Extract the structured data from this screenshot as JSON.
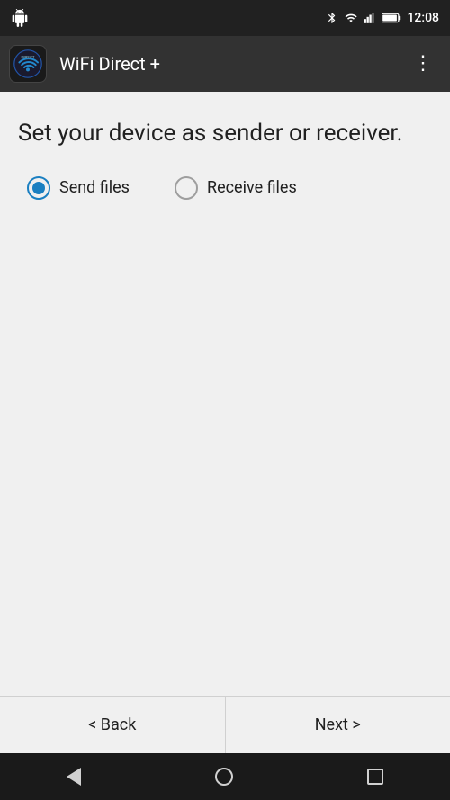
{
  "statusBar": {
    "time": "12:08"
  },
  "appBar": {
    "title": "WiFi Direct +"
  },
  "main": {
    "description": "Set your device as sender or receiver.",
    "radioOptions": [
      {
        "label": "Send files",
        "selected": true
      },
      {
        "label": "Receive files",
        "selected": false
      }
    ]
  },
  "bottomNav": {
    "backLabel": "< Back",
    "nextLabel": "Next >"
  }
}
